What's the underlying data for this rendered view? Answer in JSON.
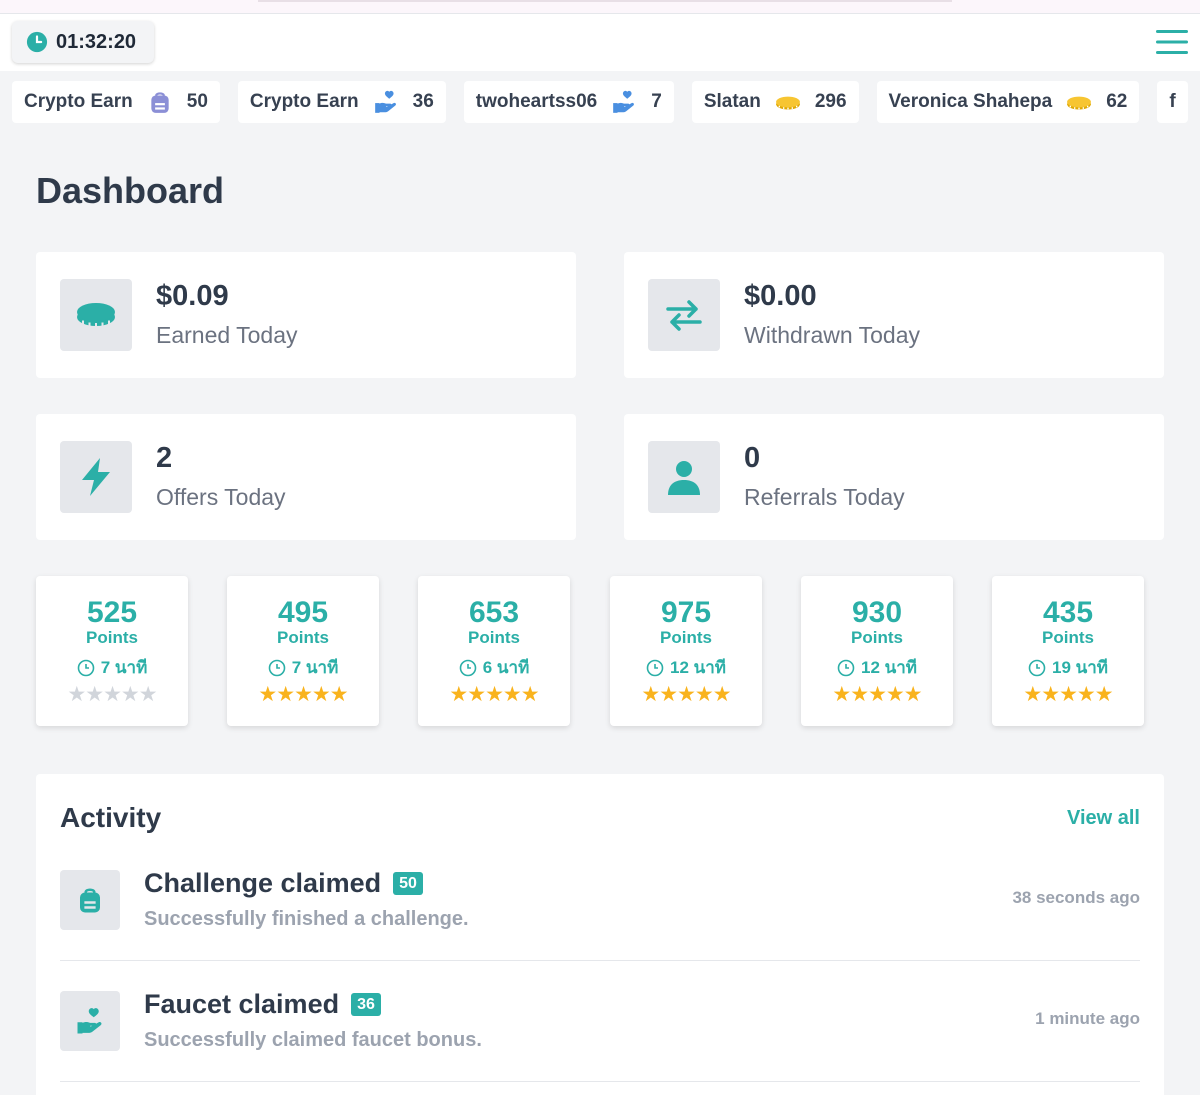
{
  "header": {
    "timer": "01:32:20",
    "menu_icon": "hamburger-menu-icon"
  },
  "ticker": [
    {
      "name": "Crypto Earn",
      "icon": "backpack-icon",
      "value": "50"
    },
    {
      "name": "Crypto Earn",
      "icon": "hand-heart-icon",
      "value": "36"
    },
    {
      "name": "twoheartss06",
      "icon": "hand-heart-icon",
      "value": "7"
    },
    {
      "name": "Slatan",
      "icon": "coins-icon",
      "value": "296"
    },
    {
      "name": "Veronica Shahepa",
      "icon": "coins-icon",
      "value": "62"
    },
    {
      "name": "f",
      "icon": "",
      "value": ""
    }
  ],
  "page_title": "Dashboard",
  "stats": [
    {
      "value": "$0.09",
      "label": "Earned Today",
      "icon": "coin-icon"
    },
    {
      "value": "$0.00",
      "label": "Withdrawn Today",
      "icon": "transfer-arrows-icon"
    },
    {
      "value": "2",
      "label": "Offers Today",
      "icon": "lightning-icon"
    },
    {
      "value": "0",
      "label": "Referrals Today",
      "icon": "user-icon"
    }
  ],
  "offers": [
    {
      "points": "525",
      "points_label": "Points",
      "time": "7 นาที",
      "rating": 0
    },
    {
      "points": "495",
      "points_label": "Points",
      "time": "7 นาที",
      "rating": 5
    },
    {
      "points": "653",
      "points_label": "Points",
      "time": "6 นาที",
      "rating": 5
    },
    {
      "points": "975",
      "points_label": "Points",
      "time": "12 นาที",
      "rating": 5
    },
    {
      "points": "930",
      "points_label": "Points",
      "time": "12 นาที",
      "rating": 5
    },
    {
      "points": "435",
      "points_label": "Points",
      "time": "19 นาที",
      "rating": 5
    }
  ],
  "activity": {
    "title": "Activity",
    "view_all": "View all",
    "items": [
      {
        "title": "Challenge claimed",
        "badge": "50",
        "description": "Successfully finished a challenge.",
        "time": "38 seconds ago",
        "icon": "backpack-icon"
      },
      {
        "title": "Faucet claimed",
        "badge": "36",
        "description": "Successfully claimed faucet bonus.",
        "time": "1 minute ago",
        "icon": "hand-heart-icon"
      }
    ]
  },
  "colors": {
    "accent": "#2bafa7",
    "star": "#f9b31d",
    "star_empty": "#d1d5db",
    "background": "#f3f4f6",
    "text_dark": "#2f3a4a",
    "text_muted": "#6b7280"
  }
}
